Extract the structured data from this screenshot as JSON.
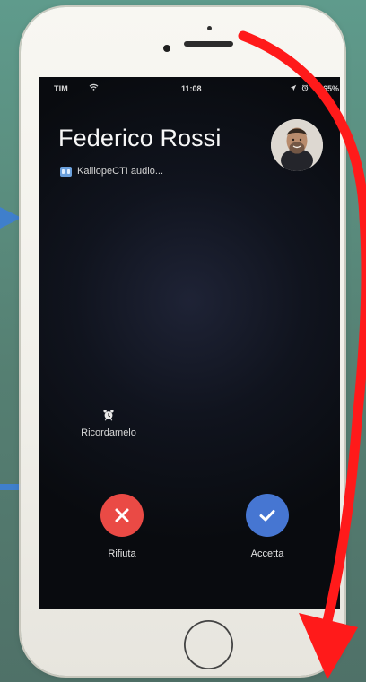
{
  "status_bar": {
    "carrier": "TIM",
    "time": "11:08",
    "battery": "65%"
  },
  "incoming_call": {
    "caller_name": "Federico Rossi",
    "app_name": "KalliopeCTI audio..."
  },
  "actions": {
    "snooze_label": "Ricordamelo",
    "reject_label": "Rifiuta",
    "accept_label": "Accetta"
  },
  "icons": {
    "left_arrow": "arrow-right-icon",
    "red_arrow": "curved-arrow-icon",
    "wifi": "wifi-icon",
    "location": "location-icon",
    "alarm_status": "alarm-icon",
    "bluetooth": "bluetooth-icon",
    "app": "app-icon",
    "snooze": "alarm-clock-icon",
    "reject": "close-icon",
    "accept": "check-icon"
  },
  "colors": {
    "reject": "#ea4a45",
    "accept": "#4676d2",
    "annotation_arrow": "#ff1a1a",
    "side_arrows": "#3f7fcc"
  }
}
